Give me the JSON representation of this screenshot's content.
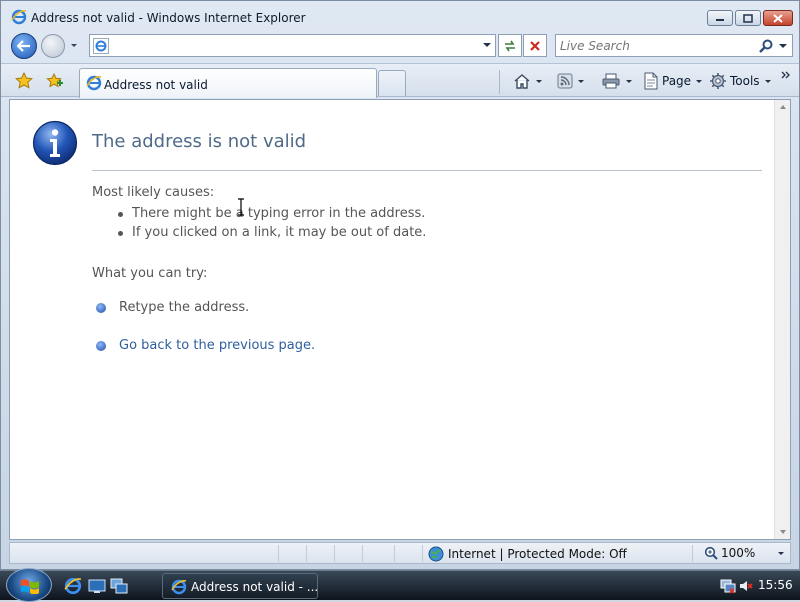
{
  "window": {
    "title": "Address not valid - Windows Internet Explorer"
  },
  "navigation": {
    "address_value": "",
    "search_placeholder": "Live Search"
  },
  "tabs": [
    {
      "label": "Address not valid",
      "active": true
    }
  ],
  "toolbar": {
    "page_label": "Page",
    "tools_label": "Tools"
  },
  "error_page": {
    "title": "The address is not valid",
    "causes_heading": "Most likely causes:",
    "causes": [
      "There might be a typing error in the address.",
      "If you clicked on a link, it may be out of date."
    ],
    "try_heading": "What you can try:",
    "retype": "Retype the address.",
    "go_back": "Go back to the previous page."
  },
  "statusbar": {
    "zone": "Internet | Protected Mode: Off",
    "zoom": "100%"
  },
  "taskbar": {
    "task_label": "Address not valid - ...",
    "clock": "15:56"
  },
  "colors": {
    "accent": "#2f5f9e",
    "title_text": "#4f6a88"
  },
  "icons": {
    "page_icon": "info-icon",
    "browser": "ie-icon"
  }
}
